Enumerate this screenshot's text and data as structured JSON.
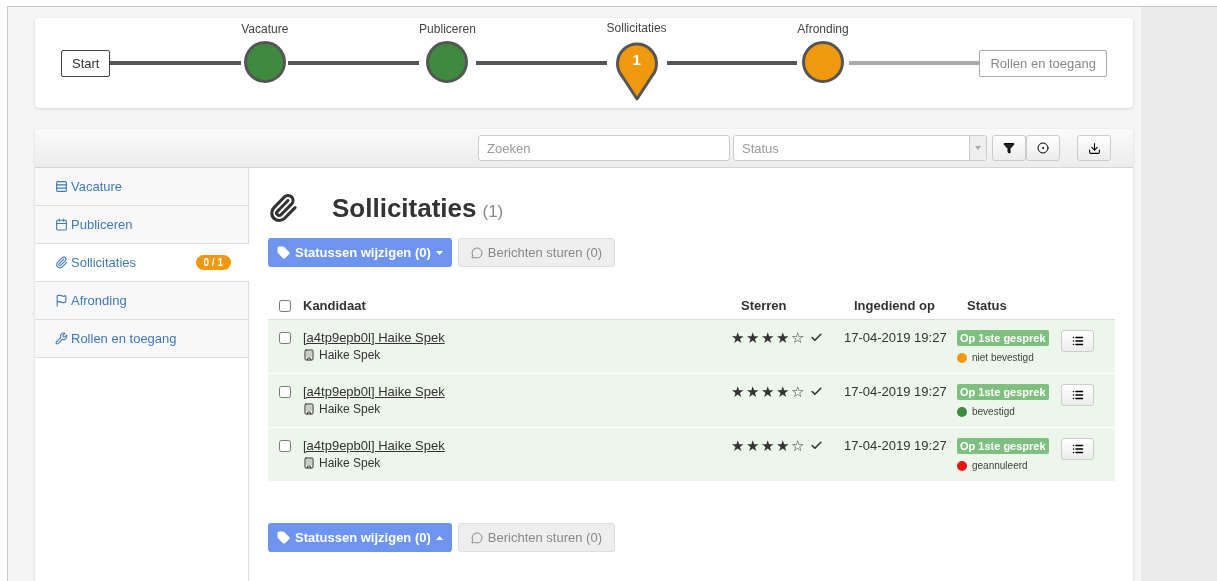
{
  "stepper": [
    {
      "kind": "box",
      "label": "Start",
      "disabled": false
    },
    {
      "kind": "circle",
      "label": "Vacature",
      "color": "#3f8a3f"
    },
    {
      "kind": "circle",
      "label": "Publiceren",
      "color": "#3f8a3f"
    },
    {
      "kind": "pin",
      "label": "Sollicitaties",
      "color": "#f0980e",
      "count": "1"
    },
    {
      "kind": "circle",
      "label": "Afronding",
      "color": "#f0980e"
    },
    {
      "kind": "box",
      "label": "Rollen en toegang",
      "disabled": true
    }
  ],
  "toolbar": {
    "search": {
      "placeholder": "Zoeken"
    },
    "status": {
      "placeholder": "Status"
    }
  },
  "sidebar": {
    "items": [
      {
        "kind": "rows",
        "label": "Vacature",
        "selected": false
      },
      {
        "kind": "calendar",
        "label": "Publiceren",
        "selected": false
      },
      {
        "kind": "paperclip",
        "label": "Sollicitaties",
        "selected": true,
        "badge": "0 / 1"
      },
      {
        "kind": "flag",
        "label": "Afronding",
        "selected": false
      },
      {
        "kind": "wrench",
        "label": "Rollen en toegang",
        "selected": false
      }
    ]
  },
  "content": {
    "title": "Sollicitaties",
    "count": "(1)",
    "actions_top": {
      "status_button": "Statussen wijzigen (0)",
      "message_button": "Berichten sturen (0)"
    },
    "table": {
      "select_all": {
        "checked": false
      },
      "columns": [
        "Kandidaat",
        "Sterren",
        "Ingediend op",
        "Status"
      ],
      "rows": [
        {
          "checked": false,
          "candidate": "[a4tp9epb0l] Haike Spek",
          "company": "Haike Spek",
          "stars": 4,
          "submitted": "17-04-2019 19:27",
          "status": "Op 1ste gesprek",
          "sub_status": "niet bevestigd",
          "color": "#f0980e"
        },
        {
          "checked": false,
          "candidate": "[a4tp9epb0l] Haike Spek",
          "company": "Haike Spek",
          "stars": 4,
          "submitted": "17-04-2019 19:27",
          "status": "Op 1ste gesprek",
          "sub_status": "bevestigd",
          "color": "#3f8a3f"
        },
        {
          "checked": false,
          "candidate": "[a4tp9epb0l] Haike Spek",
          "company": "Haike Spek",
          "stars": 4,
          "submitted": "17-04-2019 19:27",
          "status": "Op 1ste gesprek",
          "sub_status": "geannuleerd",
          "color": "#e31515"
        }
      ]
    },
    "actions_bottom": {
      "status_button": "Statussen wijzigen (0)",
      "message_button": "Berichten sturen (0)"
    }
  }
}
